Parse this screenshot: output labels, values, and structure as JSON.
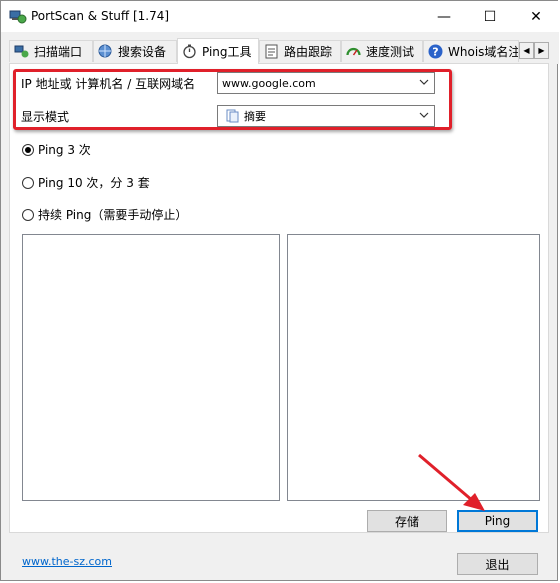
{
  "window": {
    "title": "PortScan & Stuff [1.74]",
    "controls": {
      "minimize": "—",
      "maximize": "☐",
      "close": "✕"
    }
  },
  "tabs": [
    {
      "label": "扫描端口",
      "icon": "network-scan-icon"
    },
    {
      "label": "搜索设备",
      "icon": "globe-search-icon"
    },
    {
      "label": "Ping工具",
      "icon": "stopwatch-icon",
      "active": true
    },
    {
      "label": "路由跟踪",
      "icon": "route-icon"
    },
    {
      "label": "速度测试",
      "icon": "speedometer-icon"
    },
    {
      "label": "Whois域名注",
      "icon": "help-icon"
    }
  ],
  "form": {
    "host_label": "IP 地址或 计算机名 / 互联网域名",
    "host_value": "www.google.com",
    "mode_label": "显示模式",
    "mode_value": "摘要"
  },
  "ping_options": [
    {
      "label": "Ping 3 次",
      "selected": true
    },
    {
      "label": "Ping 10 次，分 3 套",
      "selected": false
    },
    {
      "label": "持续 Ping（需要手动停止）",
      "selected": false
    }
  ],
  "buttons": {
    "save": "存储",
    "ping": "Ping",
    "exit": "退出"
  },
  "footer": {
    "link": "www.the-sz.com"
  },
  "colors": {
    "highlight": "#e0202a",
    "accent": "#0078d7",
    "link": "#0066cc"
  }
}
